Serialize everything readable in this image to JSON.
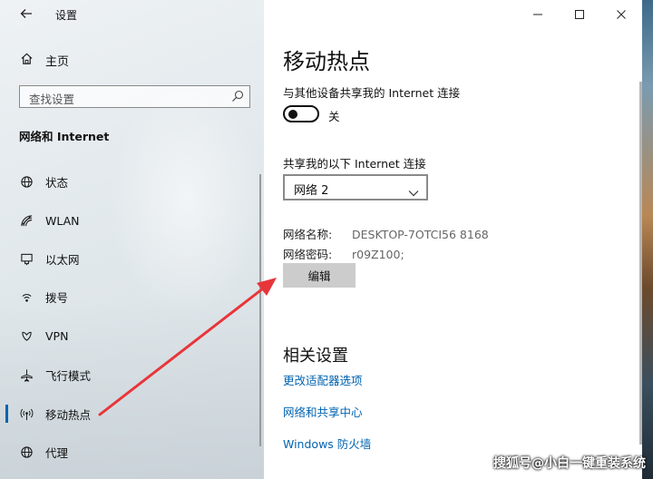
{
  "window": {
    "title": "设置",
    "controls": {
      "minimize": "—",
      "maximize": "☐",
      "close": "✕"
    }
  },
  "sidebar": {
    "home_label": "主页",
    "search_placeholder": "查找设置",
    "section_title": "网络和 Internet",
    "items": [
      {
        "label": "状态",
        "icon": "status-globe-icon"
      },
      {
        "label": "WLAN",
        "icon": "wifi-icon"
      },
      {
        "label": "以太网",
        "icon": "ethernet-icon"
      },
      {
        "label": "拨号",
        "icon": "dialup-icon"
      },
      {
        "label": "VPN",
        "icon": "vpn-icon"
      },
      {
        "label": "飞行模式",
        "icon": "airplane-icon"
      },
      {
        "label": "移动热点",
        "icon": "hotspot-icon",
        "active": true
      },
      {
        "label": "代理",
        "icon": "proxy-globe-icon"
      }
    ]
  },
  "main": {
    "title": "移动热点",
    "share_subtitle": "与其他设备共享我的 Internet 连接",
    "toggle_state_label": "关",
    "share_from_label": "共享我的以下 Internet 连接",
    "share_from_value": "网络 2",
    "network_name_label": "网络名称:",
    "network_name_value": "DESKTOP-7OTCI56 8168",
    "network_password_label": "网络密码:",
    "network_password_value": "r09Z100;",
    "edit_button": "编辑",
    "related_title": "相关设置",
    "links": [
      "更改适配器选项",
      "网络和共享中心",
      "Windows 防火墙"
    ]
  },
  "watermark": "搜狐号@小白一键重装系统",
  "colors": {
    "accent": "#0063b1",
    "arrow": "#e8353a"
  }
}
